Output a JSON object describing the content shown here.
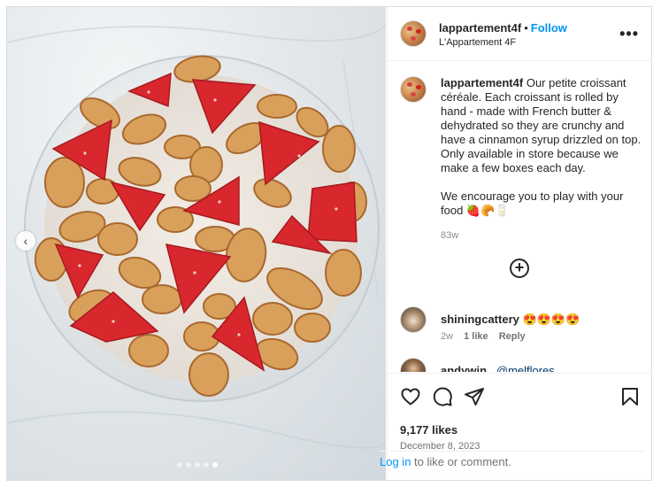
{
  "post": {
    "username": "lappartement4f",
    "location": "L'Appartement 4F",
    "follow_label": "Follow",
    "more_glyph": "•••",
    "caption": "Our petite croissant céréale. Each croissant is rolled by hand - made with French butter & dehydrated so they are crunchy and have a cinnamon syrup drizzled on top. Only available in store because we make a few boxes each day.\n\nWe encourage you to play with your food 🍓🥐🥛",
    "caption_time": "83w",
    "likes": "9,177 likes",
    "date": "December 8, 2023",
    "carousel": {
      "dot_count": 5,
      "active_index": 4
    }
  },
  "comments": [
    {
      "username": "shiningcattery",
      "text": "😍😍😍😍",
      "time": "2w",
      "likes": "1 like",
      "reply": "Reply",
      "avatar": "cat"
    },
    {
      "username": "andywin_",
      "text": "@melflores",
      "time": "",
      "likes": "",
      "reply": "",
      "avatar": "person"
    }
  ],
  "footer": {
    "login_link": "Log in",
    "login_rest": " to like or comment."
  },
  "icons": {
    "more": "more-horizontal-icon",
    "add_comments": "plus-circle-icon",
    "like": "heart-icon",
    "comment": "comment-bubble-icon",
    "share": "paper-plane-icon",
    "save": "bookmark-icon",
    "prev": "chevron-left-icon"
  }
}
